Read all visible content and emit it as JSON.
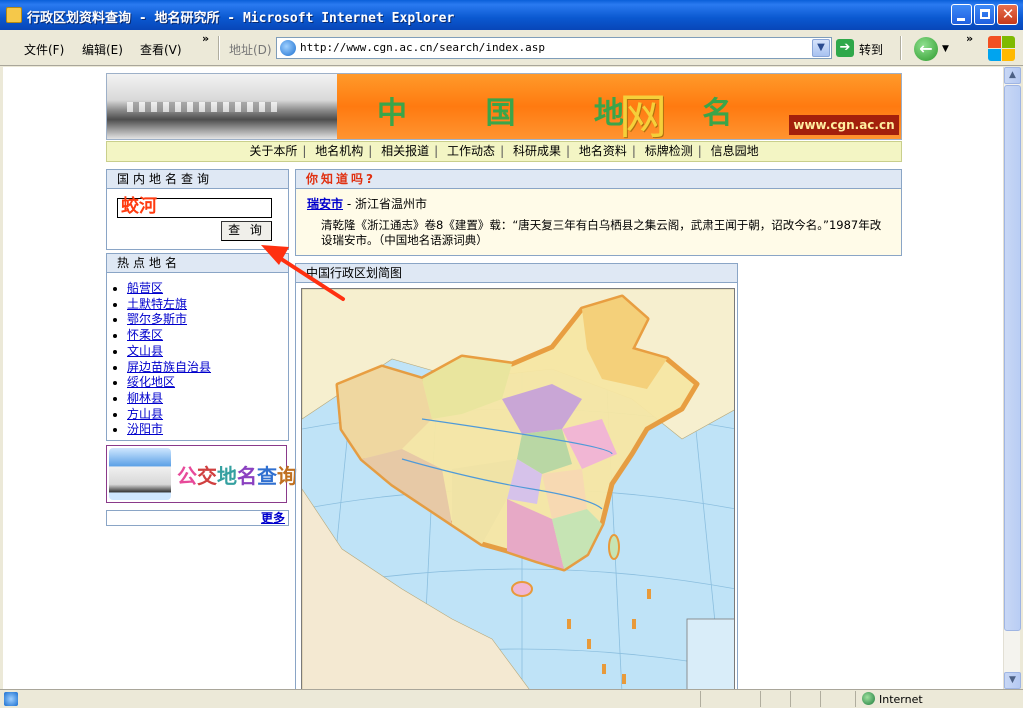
{
  "window": {
    "title": "行政区划资料查询 - 地名研究所 - Microsoft Internet Explorer"
  },
  "menu": {
    "items": [
      "文件(F)",
      "编辑(E)",
      "查看(V)"
    ],
    "more": "»"
  },
  "address": {
    "label": "地址(D)",
    "url": "http://www.cgn.ac.cn/search/index.asp",
    "go_label": "转到"
  },
  "banner": {
    "title": "中 国 地 名",
    "net_char": "网",
    "site": "www.cgn.ac.cn"
  },
  "nav": {
    "items": [
      "关于本所",
      "地名机构",
      "相关报道",
      "工作动态",
      "科研成果",
      "地名资料",
      "标牌检测",
      "信息园地"
    ]
  },
  "search": {
    "heading": "国内地名查询",
    "value": "蛟河",
    "button": "查 询"
  },
  "hot": {
    "heading": "热点地名",
    "items": [
      "船营区",
      "土默特左旗",
      "鄂尔多斯市",
      "怀柔区",
      "文山县",
      "屏边苗族自治县",
      "绥化地区",
      "柳林县",
      "方山县",
      "汾阳市"
    ]
  },
  "bus_banner": {
    "text": [
      "公",
      "交",
      "地",
      "名",
      "查",
      "询"
    ]
  },
  "more": {
    "label": "更多"
  },
  "did_you_know": {
    "heading": "你知道吗?",
    "place": "瑞安市",
    "province": " - 浙江省温州市",
    "body": "清乾隆《浙江通志》卷8《建置》载：“唐天复三年有白乌栖县之集云阁，武肃王闻于朝，诏改今名。”1987年改设瑞安市。（中国地名语源词典）"
  },
  "map": {
    "heading": "中国行政区划简图"
  },
  "status": {
    "zone": "Internet"
  },
  "colors": {
    "title_bar": "#0a58d0",
    "banner_orange": "#ff7a10",
    "link": "#0000cc",
    "search_text": "#ff3b10",
    "arrow": "#ff3010"
  }
}
